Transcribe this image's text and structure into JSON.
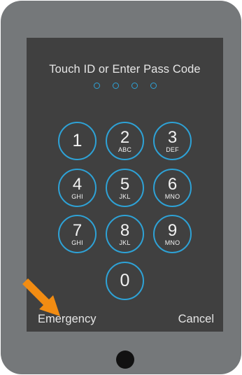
{
  "prompt": "Touch ID or Enter Pass Code",
  "passcode_dots": 4,
  "keypad": {
    "keys": [
      {
        "digit": "1",
        "letters": ""
      },
      {
        "digit": "2",
        "letters": "ABC"
      },
      {
        "digit": "3",
        "letters": "DEF"
      },
      {
        "digit": "4",
        "letters": "GHI"
      },
      {
        "digit": "5",
        "letters": "JKL"
      },
      {
        "digit": "6",
        "letters": "MNO"
      },
      {
        "digit": "7",
        "letters": "GHI"
      },
      {
        "digit": "8",
        "letters": "JKL"
      },
      {
        "digit": "9",
        "letters": "MNO"
      },
      {
        "digit": "0",
        "letters": ""
      }
    ]
  },
  "footer": {
    "emergency_label": "Emergency",
    "cancel_label": "Cancel"
  },
  "icons": {
    "pointer_arrow": "arrow-icon",
    "home_button": "home-button-icon"
  },
  "colors": {
    "device_frame": "#75787a",
    "screen_bg": "#404040",
    "accent": "#2ea2d6",
    "arrow": "#f28c12",
    "home_button": "#111111"
  }
}
